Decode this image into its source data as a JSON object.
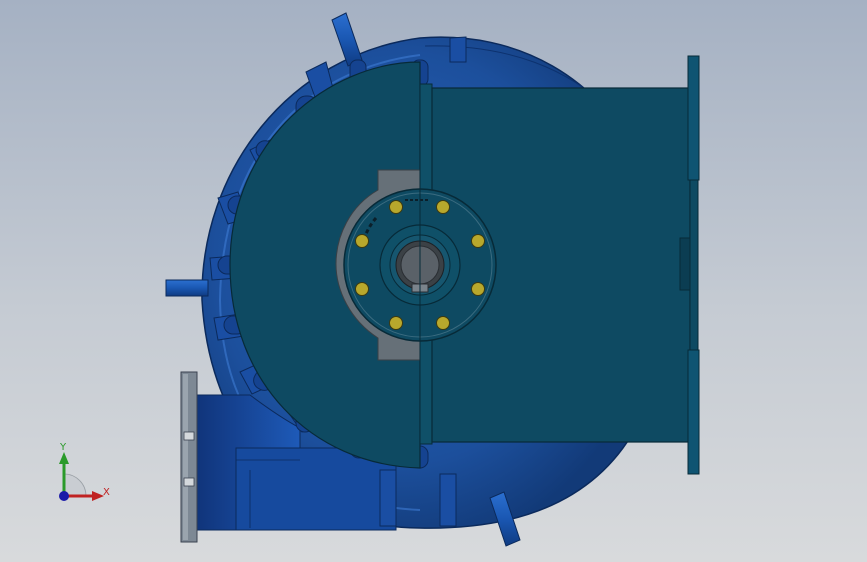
{
  "viewport": {
    "background_top": "#a5b1c3",
    "background_bottom": "#d8dadc"
  },
  "model": {
    "volute_color": "#1c4f9c",
    "casing_color": "#0e4a62",
    "flange_color": "#1e63a8",
    "bolt_color": "#b8a82c",
    "hub_color": "#5a6168"
  },
  "triad": {
    "x_label": "X",
    "y_label": "Y",
    "x_color": "#c02222",
    "y_color": "#2a9a2a",
    "z_color": "#1a1aa8"
  }
}
